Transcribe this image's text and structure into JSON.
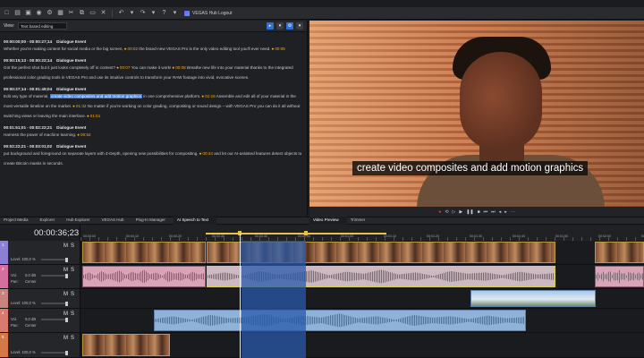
{
  "window": {
    "title": "VEGAS Hub Logout"
  },
  "script_panel": {
    "view_label": "View:",
    "view_value": "Text based editing",
    "events": [
      {
        "time": "00:00:00;00 - 00:00:27;14",
        "tag": "Dialogue Event",
        "parts": [
          {
            "t": "Whether you're making content for social media or the big screen, "
          },
          {
            "t": "⏺ 00:02",
            "m": true
          },
          {
            "t": " the brand-new VEGAS Pro is the only video editing tool you'll ever need. "
          },
          {
            "t": "⏺ 00:05",
            "m": true
          }
        ]
      },
      {
        "time": "00:00:15;13 - 00:00:22;14",
        "tag": "Dialogue Event",
        "parts": [
          {
            "t": "Got the perfect shot but it just looks completely off in context? "
          },
          {
            "t": "⏺ 00:07",
            "m": true
          },
          {
            "t": " You can make it work! "
          },
          {
            "t": "⏺ 00:08",
            "m": true
          },
          {
            "t": " Breathe new life into your material thanks to the integrated professional color grading tools in VEGAS Pro and use its intuitive controls to transform your RAW footage into vivid, evocative scenes."
          }
        ]
      },
      {
        "time": "00:00:27;14 - 00:01:49;04",
        "tag": "Dialogue Event",
        "parts": [
          {
            "t": "Edit any type of material, "
          },
          {
            "t": "create video composites and add motion graphics",
            "h": true
          },
          {
            "t": " in one comprehensive platform. "
          },
          {
            "t": "⏺ 01:16",
            "m": true
          },
          {
            "t": " Assemble and edit all of your material in the most versatile timeline on the market. "
          },
          {
            "t": "⏺ 01:32",
            "m": true
          },
          {
            "t": " No matter if you're working on color grading, compositing or sound design – with VEGAS Pro you can do it all without switching views or leaving the main interface. "
          },
          {
            "t": "⏺ 01:51",
            "m": true
          }
        ]
      },
      {
        "time": "00:01:51;01 - 00:02:22;21",
        "tag": "Dialogue Event",
        "parts": [
          {
            "t": "Harness the power of machine learning. "
          },
          {
            "t": "⏺ 00:52",
            "m": true
          }
        ]
      },
      {
        "time": "00:02:22;21 - 00:03:01;02",
        "tag": "Dialogue Event",
        "parts": [
          {
            "t": "put background and foreground on separate layers with Z-Depth, opening new possibilities for compositing. "
          },
          {
            "t": "⏺ 00:44",
            "m": true
          },
          {
            "t": " and let our AI-assisted features detect objects to create Bitcoin masks in seconds."
          }
        ]
      }
    ]
  },
  "preview": {
    "caption": "create video composites and add motion graphics"
  },
  "tabs": [
    {
      "label": "Project Media",
      "active": false
    },
    {
      "label": "Explorer",
      "active": false
    },
    {
      "label": "Hub Explorer",
      "active": false
    },
    {
      "label": "VEGAS Hub",
      "active": false
    },
    {
      "label": "Plug-In Manager",
      "active": false
    },
    {
      "label": "AI Speech to Text",
      "active": true
    }
  ],
  "preview_tabs": [
    {
      "label": "Video Preview",
      "active": true
    },
    {
      "label": "Trimmer",
      "active": false
    }
  ],
  "timeline": {
    "timecode": "00:00:36;23",
    "ruler_ticks": [
      "00:00:00",
      "00:00:10",
      "00:00:20",
      "00:00:30",
      "00:00:40",
      "00:00:50",
      "00:01:00",
      "00:01:10",
      "00:01:20",
      "00:01:30",
      "00:01:40",
      "00:01:50",
      "00:02:00",
      "00:02:10"
    ],
    "tracks": [
      {
        "num": "1",
        "color": "#8b7fd6",
        "type": "video",
        "m": "M",
        "s": "S",
        "level": "Level: 100,0 %"
      },
      {
        "num": "2",
        "color": "#d46fa0",
        "type": "audio",
        "m": "M",
        "s": "S",
        "vol": "Vol.",
        "vol_value": "0,0 dB",
        "pan": "Pan:",
        "pan_value": "Center"
      },
      {
        "num": "3",
        "color": "#c9837e",
        "type": "video",
        "m": "M",
        "s": "S",
        "level": "Level: 100,0 %"
      },
      {
        "num": "4",
        "color": "#d97a6f",
        "type": "audio",
        "m": "M",
        "s": "S",
        "vol": "Vol.",
        "vol_value": "0,0 dB",
        "pan": "Pan:",
        "pan_value": "Center"
      },
      {
        "num": "5",
        "color": "#d4784a",
        "type": "video",
        "m": "M",
        "s": "S",
        "level": "Level: 100,0 %"
      }
    ]
  }
}
